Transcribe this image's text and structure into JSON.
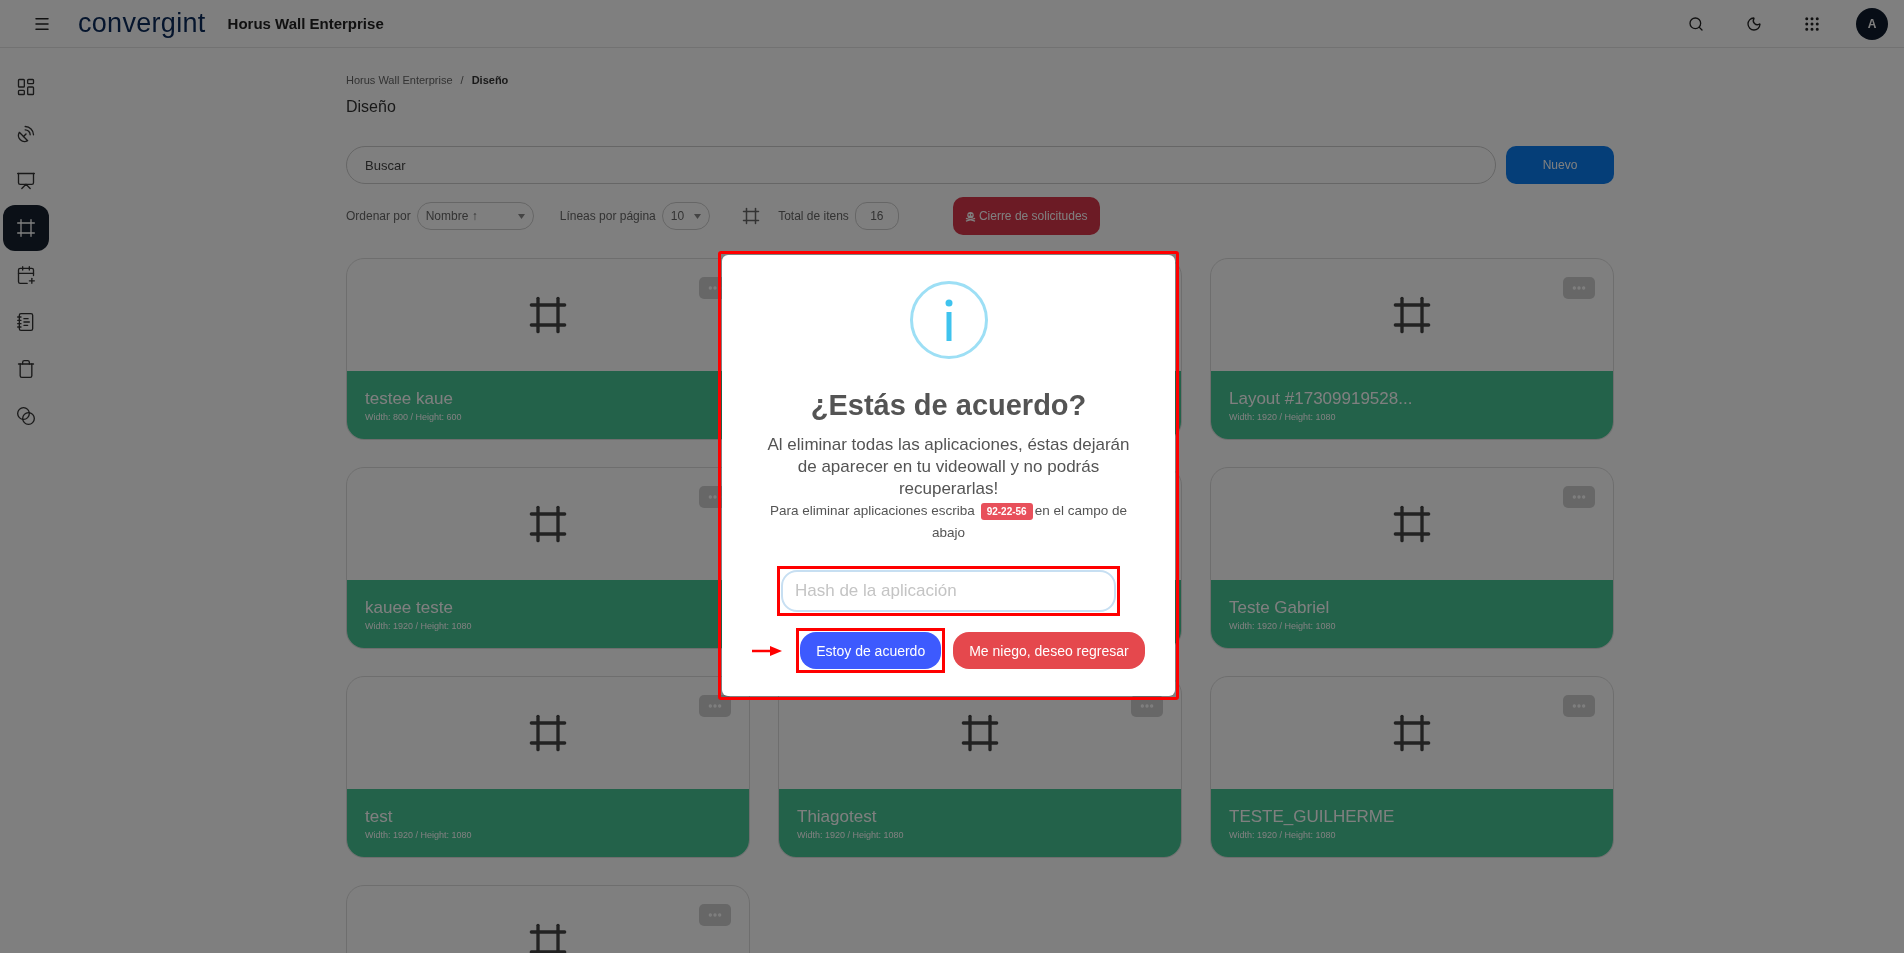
{
  "header": {
    "logo": "convergint",
    "app_title": "Horus Wall Enterprise",
    "avatar": "A"
  },
  "sidebar": {
    "items": [
      {
        "kind": "dashboard",
        "selected": false
      },
      {
        "kind": "satellite",
        "selected": false
      },
      {
        "kind": "monitor",
        "selected": false
      },
      {
        "kind": "frame",
        "selected": true
      },
      {
        "kind": "calendar",
        "selected": false
      },
      {
        "kind": "notebook",
        "selected": false
      },
      {
        "kind": "trash",
        "selected": false
      },
      {
        "kind": "copies",
        "selected": false
      }
    ]
  },
  "breadcrumb": {
    "items": [
      "Horus Wall Enterprise",
      "Diseño"
    ],
    "separator": "/"
  },
  "page_title": "Diseño",
  "search": {
    "placeholder": "Buscar"
  },
  "new_button": "Nuevo",
  "filters": {
    "sort_label": "Ordenar por",
    "sort_value": "Nombre ↑",
    "lines_label": "Líneas por página",
    "lines_value": "10",
    "total_label": "Total de itens",
    "total_value": "16",
    "close_button": "Cierre de solicitudes"
  },
  "cards": [
    {
      "kind": "full",
      "title": "testee kaue",
      "subtitle": "Width: 800 / Height: 600"
    },
    {
      "kind": "covered"
    },
    {
      "kind": "full",
      "title": "Layout #17309919528...",
      "subtitle": "Width: 1920 / Height: 1080"
    },
    {
      "kind": "full",
      "title": "kauee teste",
      "subtitle": "Width: 1920 / Height: 1080"
    },
    {
      "kind": "covered"
    },
    {
      "kind": "full",
      "title": "Teste Gabriel",
      "subtitle": "Width: 1920 / Height: 1080"
    },
    {
      "kind": "full",
      "title": "test",
      "subtitle": "Width: 1920 / Height: 1080"
    },
    {
      "kind": "full",
      "title": "Thiagotest",
      "subtitle": "Width: 1920 / Height: 1080"
    },
    {
      "kind": "full",
      "title": "TESTE_GUILHERME",
      "subtitle": "Width: 1920 / Height: 1080"
    },
    {
      "kind": "cut"
    }
  ],
  "modal": {
    "title": "¿Estás de acuerdo?",
    "message": "Al eliminar todas las aplicaciones, éstas dejarán de aparecer en tu videowall y no podrás recuperarlas!",
    "hint_before": "Para eliminar aplicaciones escriba",
    "code": "92-22-56",
    "hint_after": "en el campo de abajo",
    "input_placeholder": "Hash de la aplicación",
    "confirm_button": "Estoy de acuerdo",
    "cancel_button": "Me niego, deseo regresar"
  }
}
